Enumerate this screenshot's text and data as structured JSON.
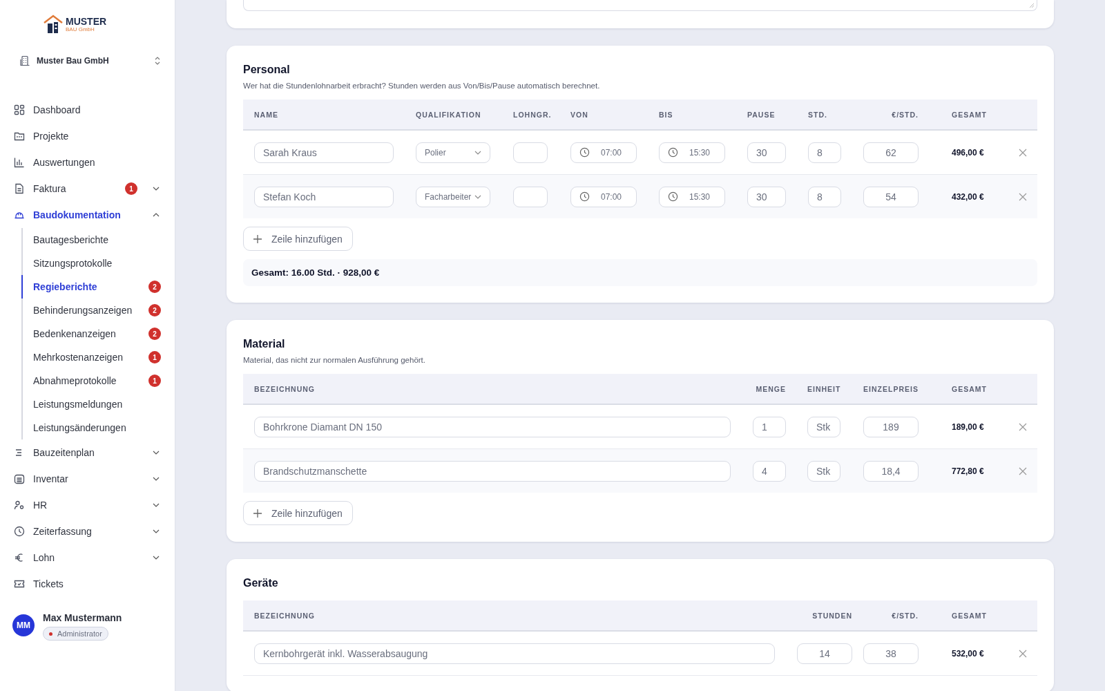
{
  "sidebar": {
    "logo": {
      "name": "MUSTER",
      "sub": "BAU GmbH"
    },
    "company": "Muster Bau GmbH",
    "nav": [
      {
        "label": "Dashboard",
        "selected": false
      },
      {
        "label": "Projekte",
        "selected": false
      },
      {
        "label": "Auswertungen",
        "selected": false
      },
      {
        "label": "Faktura",
        "selected": false,
        "badge": "1",
        "expanded": false
      },
      {
        "label": "Baudokumentation",
        "selected": true,
        "expanded": true,
        "children": [
          {
            "label": "Bautagesberichte",
            "selected": false
          },
          {
            "label": "Sitzungsprotokolle",
            "selected": false
          },
          {
            "label": "Regieberichte",
            "selected": true,
            "badge": "2"
          },
          {
            "label": "Behinderungsanzeigen",
            "selected": false,
            "badge": "2"
          },
          {
            "label": "Bedenkenanzeigen",
            "selected": false,
            "badge": "2"
          },
          {
            "label": "Mehrkostenanzeigen",
            "selected": false,
            "badge": "1"
          },
          {
            "label": "Abnahmeprotokolle",
            "selected": false,
            "badge": "1"
          },
          {
            "label": "Leistungsmeldungen",
            "selected": false
          },
          {
            "label": "Leistungsänderungen",
            "selected": false
          }
        ]
      },
      {
        "label": "Bauzeitenplan",
        "selected": false,
        "expanded": false
      },
      {
        "label": "Inventar",
        "selected": false,
        "expanded": false
      },
      {
        "label": "HR",
        "selected": false,
        "expanded": false
      },
      {
        "label": "Zeiterfassung",
        "selected": false,
        "expanded": false
      },
      {
        "label": "Lohn",
        "selected": false,
        "expanded": false
      },
      {
        "label": "Tickets",
        "selected": false
      }
    ],
    "user": {
      "initials": "MM",
      "name": "Max Mustermann",
      "role": "Administrator"
    }
  },
  "personal": {
    "title": "Personal",
    "description": "Wer hat die Stundenlohnarbeit erbracht? Stunden werden aus Von/Bis/Pause automatisch berechnet.",
    "columns": [
      "NAME",
      "QUALIFIKATION",
      "LOHNGR.",
      "VON",
      "BIS",
      "PAUSE",
      "STD.",
      "€/STD.",
      "GESAMT"
    ],
    "rows": [
      {
        "name": "Sarah Kraus",
        "qualification": "Polier",
        "von": "07:00",
        "bis": "15:30",
        "pause": "30",
        "hours": "8",
        "rate": "62",
        "total": "496,00 €"
      },
      {
        "name": "Stefan Koch",
        "qualification": "Facharbeiter",
        "von": "07:00",
        "bis": "15:30",
        "pause": "30",
        "hours": "8",
        "rate": "54",
        "total": "432,00 €"
      }
    ],
    "add_label": "Zeile hinzufügen",
    "summary": "Gesamt: 16.00 Std. · 928,00 €"
  },
  "material": {
    "title": "Material",
    "description": "Material, das nicht zur normalen Ausführung gehört.",
    "columns": [
      "BEZEICHNUNG",
      "MENGE",
      "EINHEIT",
      "EINZELPREIS",
      "GESAMT"
    ],
    "rows": [
      {
        "name": "Bohrkrone Diamant DN 150",
        "quantity": "1",
        "unit": "Stk",
        "price": "189",
        "total": "189,00 €"
      },
      {
        "name": "Brandschutzmanschette",
        "quantity": "4",
        "unit": "Stk",
        "price": "18,4",
        "total": "772,80 €"
      }
    ],
    "add_label": "Zeile hinzufügen"
  },
  "equipment": {
    "title": "Geräte",
    "columns": [
      "BEZEICHNUNG",
      "STUNDEN",
      "€/STD.",
      "GESAMT"
    ],
    "rows": [
      {
        "name": "Kernbohrgerät inkl. Wasserabsaugung",
        "hours": "14",
        "rate": "38",
        "total": "532,00 €"
      }
    ]
  }
}
